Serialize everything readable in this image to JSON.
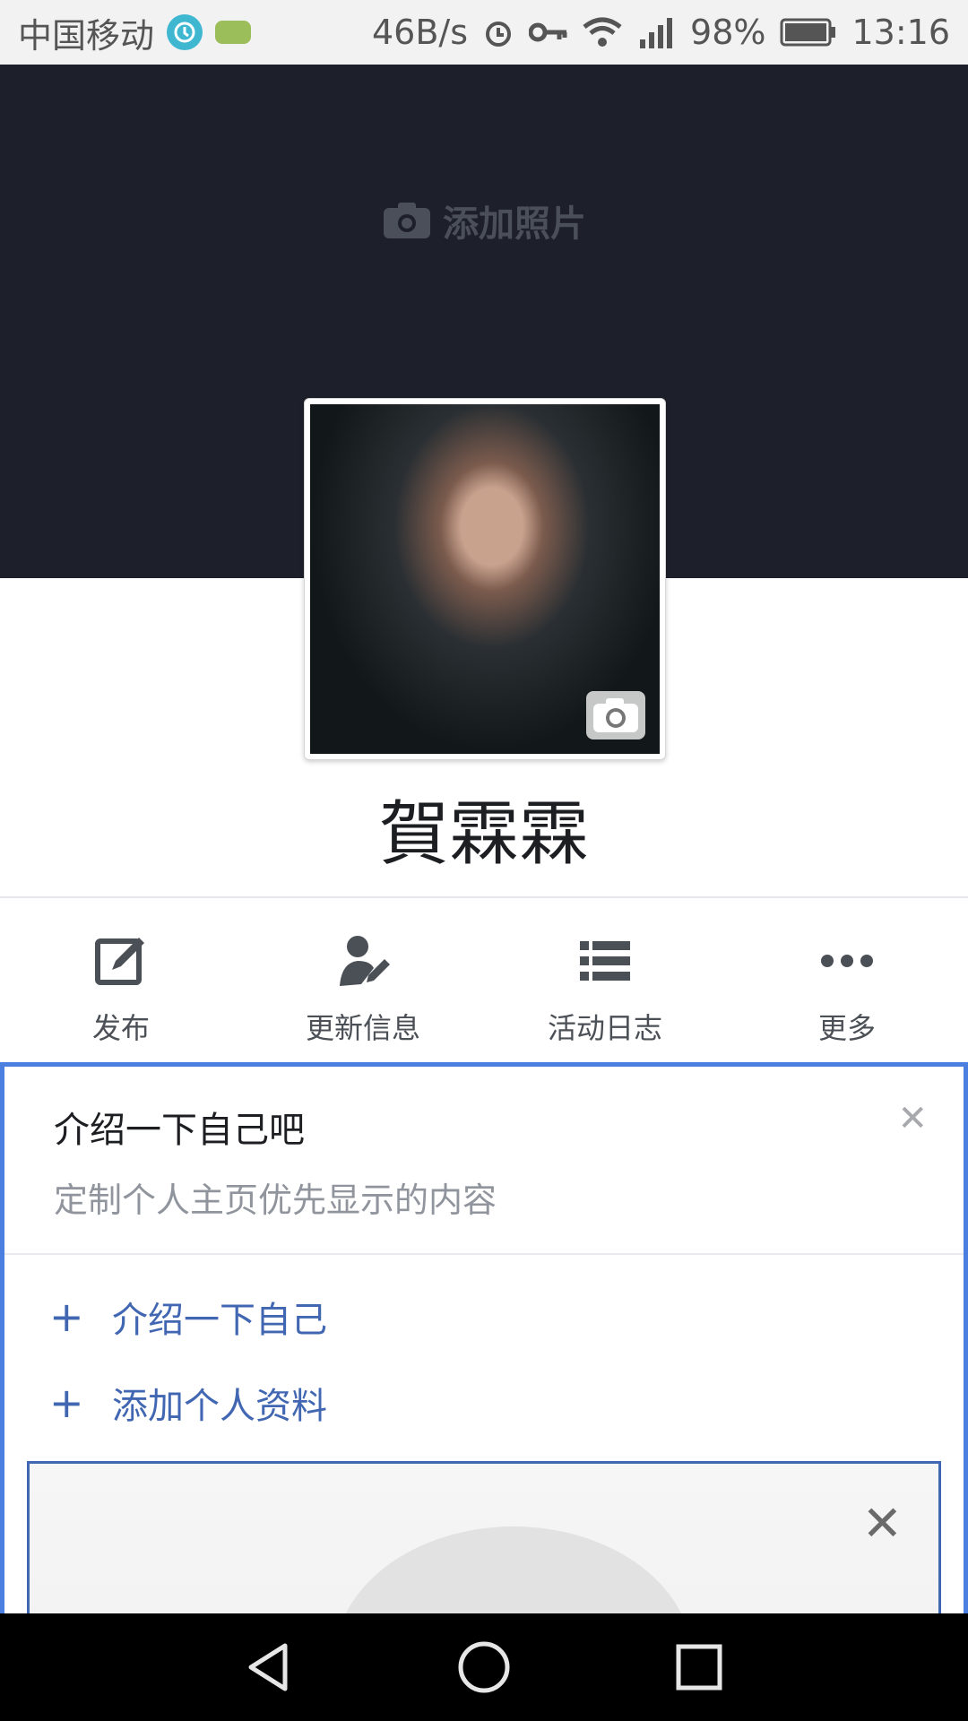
{
  "status_bar": {
    "carrier": "中国移动",
    "speed": "46B/s",
    "battery": "98%",
    "time": "13:16",
    "icons": [
      "clock-app-icon",
      "game-app-icon",
      "alarm-icon",
      "key-icon",
      "wifi-icon",
      "signal-4g-icon",
      "battery-icon"
    ]
  },
  "cover": {
    "add_photo_label": "添加照片"
  },
  "profile": {
    "name": "賀霖霖"
  },
  "actions": [
    {
      "label": "发布",
      "icon": "edit-icon"
    },
    {
      "label": "更新信息",
      "icon": "person-edit-icon"
    },
    {
      "label": "活动日志",
      "icon": "list-icon"
    },
    {
      "label": "更多",
      "icon": "more-dots-icon"
    }
  ],
  "intro": {
    "title": "介绍一下自己吧",
    "subtitle": "定制个人主页优先显示的内容",
    "links": [
      {
        "label": "介绍一下自己"
      },
      {
        "label": "添加个人资料"
      }
    ]
  },
  "colors": {
    "cover_bg": "#1d202b",
    "accent_blue": "#4267b2",
    "card_border": "#4a7fe0"
  }
}
